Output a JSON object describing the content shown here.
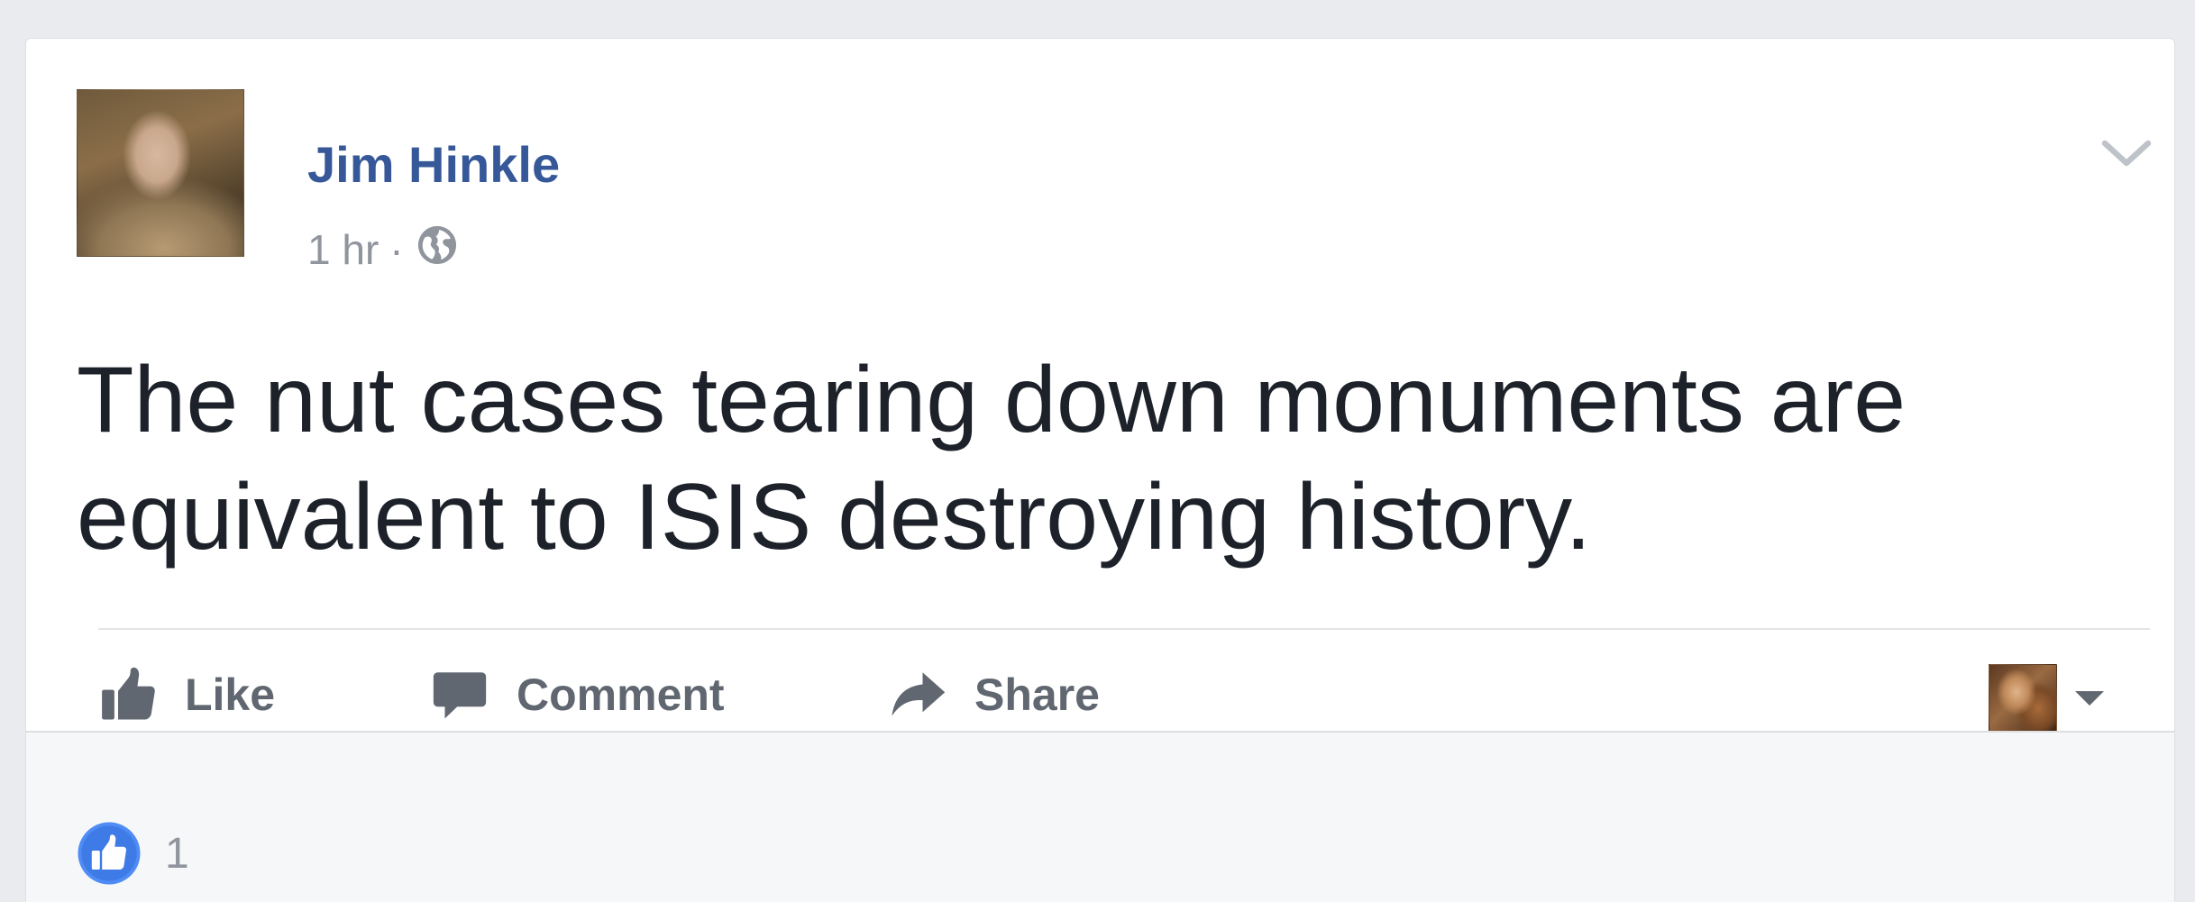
{
  "post": {
    "author": "Jim Hinkle",
    "timestamp": "1 hr",
    "separator": "·",
    "privacy_icon": "globe-icon",
    "text": "The nut cases tearing down monuments are equivalent to ISIS destroying history."
  },
  "actions": {
    "like_label": "Like",
    "comment_label": "Comment",
    "share_label": "Share"
  },
  "reactions": {
    "icon": "like-reaction-icon",
    "count": "1"
  },
  "colors": {
    "author_link": "#365899",
    "meta_text": "#90949c",
    "action_text": "#606770",
    "like_blue": "#4267b2",
    "page_bg": "#e9ebee",
    "footer_bg": "#f6f7f9"
  }
}
